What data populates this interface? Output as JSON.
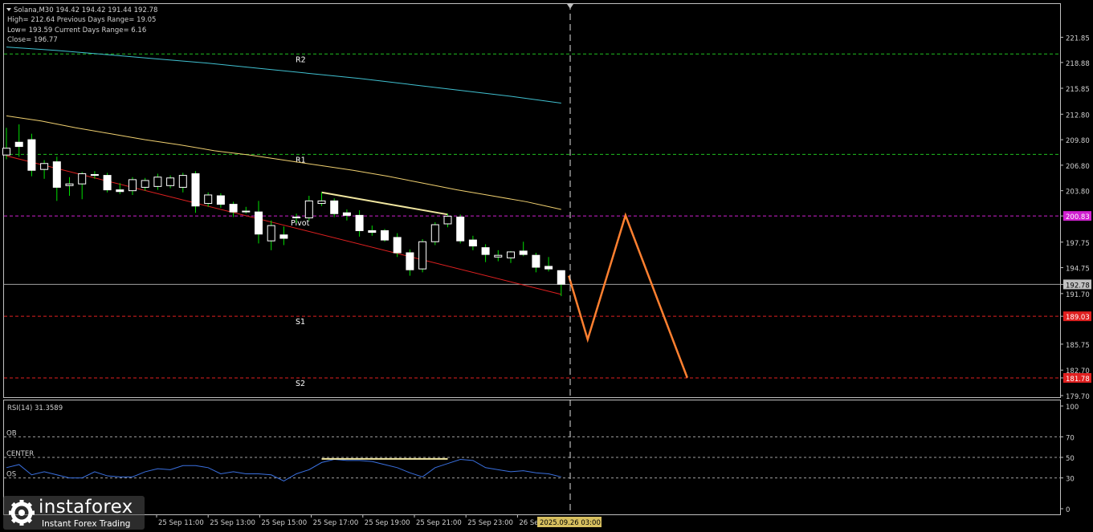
{
  "header": {
    "symbol_line": "Solana,M30  194.42 194.42 191.44 192.78",
    "high_line": "High= 212.64    Previous Days Range= 19.05",
    "low_line": "Low= 193.59    Current Days Range= 6.16",
    "close_line": "Close= 196.77"
  },
  "rsi_label": "RSI(14) 31.3589",
  "watermark": {
    "name": "instaforex",
    "sub": "Instant Forex Trading"
  },
  "colors": {
    "background": "#000000",
    "frame": "#c0c0c0",
    "bull": "#ffffff",
    "bear": "#ffffff",
    "wick": "#00e000",
    "ma_fast": "#f0d070",
    "ma_slow": "#40c0d0",
    "trendline": "#e02020",
    "divergence": "#f0e6a0",
    "forecast": "#ff8030",
    "r_level": "#20c020",
    "pivot_level": "#d020d0",
    "s_level": "#e02020",
    "rsi_line": "#3a70e0",
    "rsi_level": "#a0a0a0",
    "time_marker": "#e0e0e0",
    "time_marker_bg": "#d8c060"
  },
  "chart_data": [
    {
      "type": "candlestick",
      "title": "Solana,M30",
      "ylim": [
        179.7,
        223.4
      ],
      "y_ticks": [
        "221.85",
        "218.88",
        "215.85",
        "212.80",
        "209.80",
        "206.80",
        "203.80",
        "200.83",
        "197.75",
        "194.75",
        "192.78",
        "191.70",
        "189.03",
        "185.75",
        "182.70",
        "181.78",
        "179.70"
      ],
      "x_ticks": [
        "25 Sep 11:00",
        "25 Sep 13:00",
        "25 Sep 15:00",
        "25 Sep 17:00",
        "25 Sep 19:00",
        "25 Sep 21:00",
        "25 Sep 23:00",
        "26 Se"
      ],
      "current_price": 192.78,
      "levels": [
        {
          "name": "R2",
          "value": 219.88,
          "label": "219.88",
          "kind": "r"
        },
        {
          "name": "R1",
          "value": 208.08,
          "label": "208.08",
          "kind": "r"
        },
        {
          "name": "Pivot",
          "value": 200.83,
          "label": "200.83",
          "kind": "pivot"
        },
        {
          "name": "S1",
          "value": 189.03,
          "label": "189.03",
          "kind": "s"
        },
        {
          "name": "S2",
          "value": 181.78,
          "label": "181.78",
          "kind": "s"
        }
      ],
      "candles": [
        {
          "o": 208.0,
          "h": 211.2,
          "l": 207.5,
          "c": 208.8
        },
        {
          "o": 209.5,
          "h": 211.6,
          "l": 207.8,
          "c": 209.0
        },
        {
          "o": 209.8,
          "h": 210.5,
          "l": 205.5,
          "c": 206.2
        },
        {
          "o": 206.3,
          "h": 207.4,
          "l": 205.2,
          "c": 207.0
        },
        {
          "o": 207.2,
          "h": 207.8,
          "l": 202.6,
          "c": 204.2
        },
        {
          "o": 204.4,
          "h": 205.4,
          "l": 203.2,
          "c": 204.6
        },
        {
          "o": 204.6,
          "h": 206.0,
          "l": 202.8,
          "c": 205.8
        },
        {
          "o": 205.7,
          "h": 206.1,
          "l": 205.2,
          "c": 205.6
        },
        {
          "o": 205.6,
          "h": 205.9,
          "l": 203.6,
          "c": 203.9
        },
        {
          "o": 203.9,
          "h": 204.7,
          "l": 203.4,
          "c": 203.7
        },
        {
          "o": 203.8,
          "h": 205.4,
          "l": 203.3,
          "c": 205.1
        },
        {
          "o": 204.2,
          "h": 205.3,
          "l": 203.8,
          "c": 205.0
        },
        {
          "o": 204.3,
          "h": 205.8,
          "l": 203.9,
          "c": 205.4
        },
        {
          "o": 204.4,
          "h": 205.6,
          "l": 204.1,
          "c": 205.3
        },
        {
          "o": 204.2,
          "h": 205.9,
          "l": 203.6,
          "c": 205.6
        },
        {
          "o": 205.8,
          "h": 206.1,
          "l": 201.2,
          "c": 202.0
        },
        {
          "o": 202.3,
          "h": 203.6,
          "l": 201.9,
          "c": 203.3
        },
        {
          "o": 203.2,
          "h": 203.5,
          "l": 201.8,
          "c": 202.2
        },
        {
          "o": 202.2,
          "h": 202.5,
          "l": 200.7,
          "c": 201.3
        },
        {
          "o": 201.4,
          "h": 201.9,
          "l": 201.1,
          "c": 201.4
        },
        {
          "o": 201.3,
          "h": 202.6,
          "l": 197.6,
          "c": 198.7
        },
        {
          "o": 197.9,
          "h": 200.3,
          "l": 196.8,
          "c": 199.7
        },
        {
          "o": 198.6,
          "h": 199.6,
          "l": 197.4,
          "c": 198.2
        },
        {
          "o": 200.6,
          "h": 201.1,
          "l": 200.0,
          "c": 200.7
        },
        {
          "o": 200.6,
          "h": 203.2,
          "l": 200.3,
          "c": 202.6
        },
        {
          "o": 202.3,
          "h": 203.6,
          "l": 202.0,
          "c": 202.6
        },
        {
          "o": 202.6,
          "h": 202.9,
          "l": 200.7,
          "c": 201.1
        },
        {
          "o": 201.2,
          "h": 201.6,
          "l": 200.3,
          "c": 200.9
        },
        {
          "o": 200.9,
          "h": 201.5,
          "l": 198.4,
          "c": 199.1
        },
        {
          "o": 199.1,
          "h": 199.7,
          "l": 198.5,
          "c": 198.9
        },
        {
          "o": 199.1,
          "h": 199.3,
          "l": 197.8,
          "c": 198.0
        },
        {
          "o": 198.3,
          "h": 198.8,
          "l": 196.0,
          "c": 196.5
        },
        {
          "o": 196.5,
          "h": 196.9,
          "l": 193.8,
          "c": 194.5
        },
        {
          "o": 194.6,
          "h": 198.1,
          "l": 194.2,
          "c": 197.8
        },
        {
          "o": 197.8,
          "h": 200.1,
          "l": 197.4,
          "c": 199.8
        },
        {
          "o": 199.9,
          "h": 201.1,
          "l": 199.5,
          "c": 200.8
        },
        {
          "o": 200.7,
          "h": 201.0,
          "l": 197.6,
          "c": 197.9
        },
        {
          "o": 198.0,
          "h": 198.5,
          "l": 196.8,
          "c": 197.3
        },
        {
          "o": 197.1,
          "h": 197.5,
          "l": 195.4,
          "c": 196.3
        },
        {
          "o": 196.0,
          "h": 196.8,
          "l": 195.5,
          "c": 196.2
        },
        {
          "o": 195.9,
          "h": 196.7,
          "l": 195.3,
          "c": 196.6
        },
        {
          "o": 196.7,
          "h": 197.8,
          "l": 196.1,
          "c": 196.3
        },
        {
          "o": 196.2,
          "h": 196.5,
          "l": 194.2,
          "c": 194.8
        },
        {
          "o": 194.9,
          "h": 196.0,
          "l": 194.3,
          "c": 194.6
        },
        {
          "o": 194.4,
          "h": 194.4,
          "l": 191.4,
          "c": 192.8
        }
      ],
      "ma_fast": [
        212.6,
        212.0,
        211.2,
        210.5,
        209.8,
        209.2,
        208.5,
        208.0,
        207.4,
        206.8,
        206.2,
        205.5,
        204.7,
        203.9,
        203.2,
        202.5,
        201.6
      ],
      "ma_slow": [
        220.7,
        220.3,
        219.8,
        219.3,
        218.8,
        218.2,
        217.6,
        217.0,
        216.3,
        215.6,
        214.9,
        214.1
      ],
      "trendline": [
        [
          0,
          207.9
        ],
        [
          44,
          191.6
        ]
      ],
      "divergence_line": [
        [
          25,
          203.6
        ],
        [
          35,
          201.0
        ]
      ],
      "forecast": [
        [
          44.6,
          193.8
        ],
        [
          46.1,
          186.3
        ],
        [
          49.1,
          200.9
        ],
        [
          54.0,
          181.8
        ]
      ],
      "time_marker": {
        "label": "2025.09.26 03:00",
        "index": 44.9
      }
    },
    {
      "type": "line",
      "title": "RSI(14) 31.3589",
      "ylim": [
        0,
        100
      ],
      "y_ticks": [
        "100",
        "70",
        "50",
        "30",
        "0"
      ],
      "levels": [
        {
          "name": "OB",
          "value": 70
        },
        {
          "name": "CENTER",
          "value": 50
        },
        {
          "name": "OS",
          "value": 30
        }
      ],
      "rsi": [
        40,
        43,
        33,
        36,
        33,
        30,
        30,
        36,
        32,
        31,
        31,
        36,
        39,
        38,
        42,
        42,
        40,
        34,
        36,
        34,
        34,
        33,
        27,
        34,
        38,
        45,
        48,
        47,
        47,
        46,
        43,
        40,
        35,
        31,
        40,
        44,
        48,
        47,
        40,
        38,
        36,
        37,
        35,
        34,
        31
      ],
      "divergence_line": [
        [
          25,
          48.5
        ],
        [
          35,
          48.5
        ]
      ]
    }
  ]
}
